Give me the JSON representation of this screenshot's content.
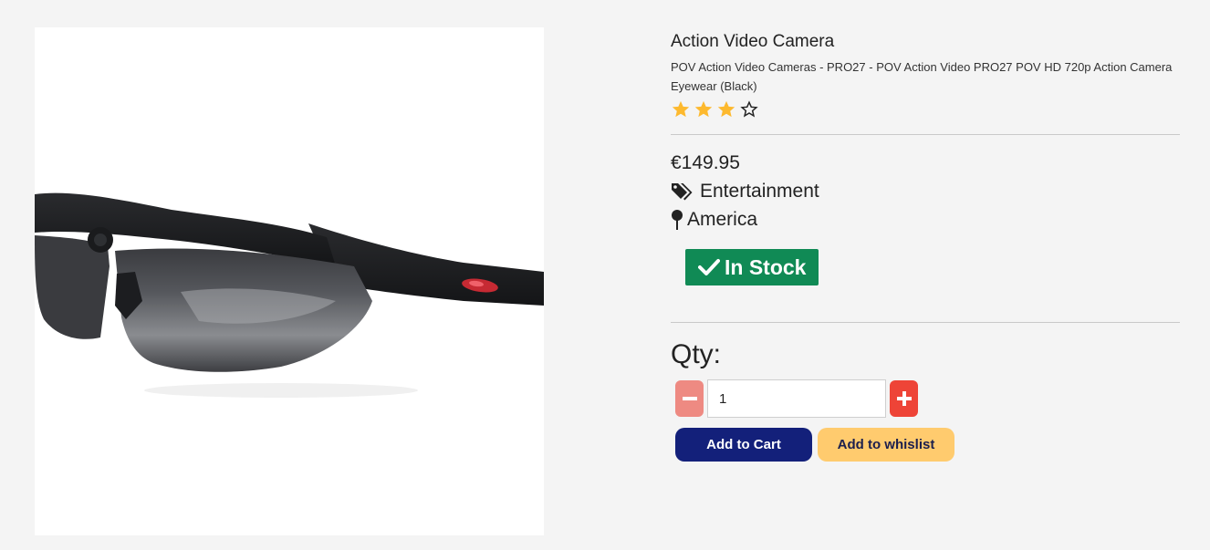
{
  "product": {
    "title": "Action Video Camera",
    "subtitle": "POV Action Video Cameras - PRO27 - POV Action Video PRO27 POV HD 720p Action Camera Eyewear (Black)",
    "rating": 3,
    "rating_max": 4,
    "price": "€149.95",
    "category": "Entertainment",
    "location": "America",
    "stock": "In Stock",
    "image_alt": "Black action camera eyewear"
  },
  "quantity": {
    "label": "Qty:",
    "value": "1"
  },
  "actions": {
    "add_to_cart": "Add to Cart",
    "add_to_wishlist": "Add to whislist"
  },
  "colors": {
    "page_bg": "#f4f4f4",
    "star": "#fdb92e",
    "stock_badge": "#108a55",
    "qty_minus": "#ee8a82",
    "qty_plus": "#ee4437",
    "cart_button": "#13207a",
    "wishlist_button": "#ffcb6e"
  },
  "icons": [
    "tags-icon",
    "map-pin-icon",
    "check-icon",
    "minus-icon",
    "plus-icon",
    "star-icon"
  ]
}
